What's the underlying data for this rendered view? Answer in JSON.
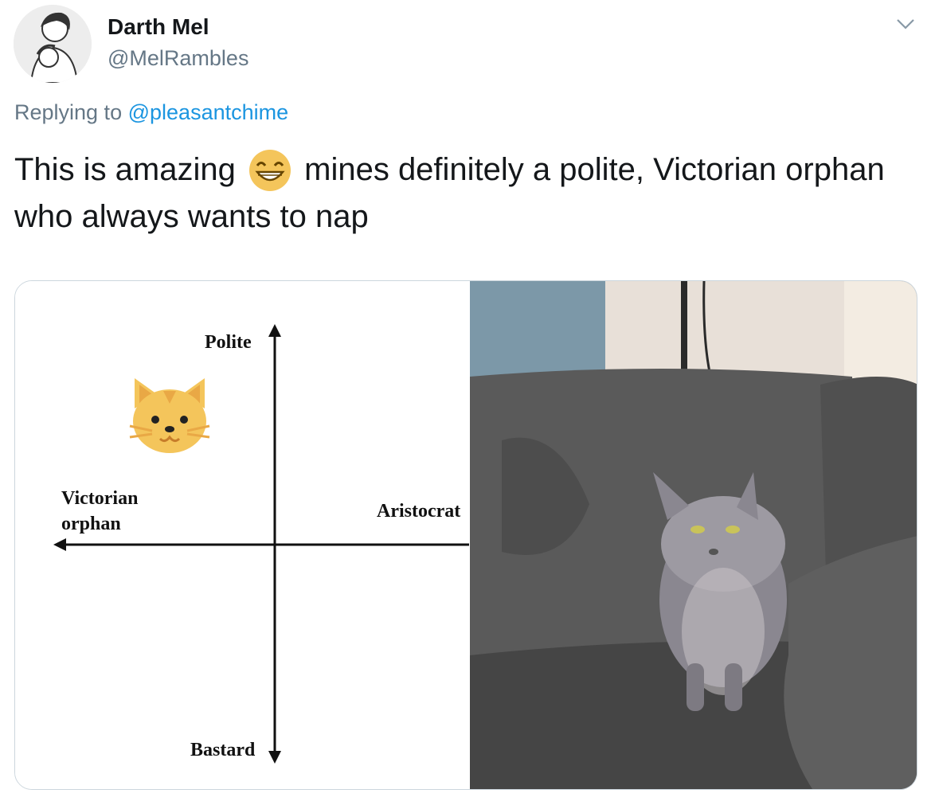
{
  "tweet": {
    "display_name": "Darth Mel",
    "handle": "@MelRambles",
    "replying_prefix": "Replying to",
    "replying_to": "@pleasantchime",
    "text_before_emoji": "This is amazing",
    "emoji": "grinning-face-with-smiling-eyes",
    "text_after_emoji": "mines definitely a polite, Victorian orphan who always wants to nap"
  },
  "chart": {
    "top_label": "Polite",
    "bottom_label": "Bastard",
    "left_label_line1": "Victorian",
    "left_label_line2": "orphan",
    "right_label": "Aristocrat",
    "marker_icon": "cat-face-icon"
  },
  "photo": {
    "description_icon": "cat-photo"
  },
  "colors": {
    "link": "#1b95e0",
    "secondary_text": "#657786",
    "cat_emoji": "#f4c55b",
    "sofa": "#4a4a4a"
  }
}
